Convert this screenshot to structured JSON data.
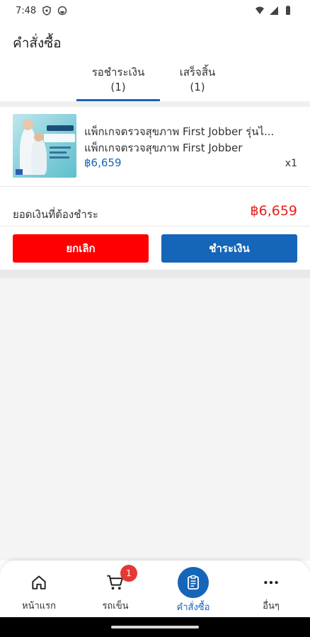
{
  "status_bar": {
    "time": "7:48"
  },
  "header": {
    "title": "คำสั่งซื้อ"
  },
  "tabs": [
    {
      "label": "รอชำระเงิน",
      "count": "(1)",
      "active": true
    },
    {
      "label": "เสร็จสิ้น",
      "count": "(1)",
      "active": false
    }
  ],
  "order": {
    "product_name_line1": "แพ็กเกจตรวจสุขภาพ First Jobber รุ่นไ...",
    "product_name_line2": "แพ็กเกจตรวจสุขภาพ First Jobber",
    "price": "฿6,659",
    "quantity": "x1",
    "total_label": "ยอดเงินที่ต้องชำระ",
    "total_value": "฿6,659",
    "cancel_label": "ยกเลิก",
    "pay_label": "ชำระเงิน"
  },
  "bottom_nav": {
    "items": [
      {
        "label": "หน้าแรก",
        "icon": "home-icon"
      },
      {
        "label": "รถเข็น",
        "icon": "cart-icon",
        "badge": "1"
      },
      {
        "label": "คำสั่งซื้อ",
        "icon": "clipboard-icon",
        "active": true
      },
      {
        "label": "อื่นๆ",
        "icon": "more-icon"
      }
    ]
  },
  "colors": {
    "accent": "#1565b8",
    "danger": "#ff0000",
    "total_price": "#e81d1d",
    "badge": "#e53935"
  }
}
